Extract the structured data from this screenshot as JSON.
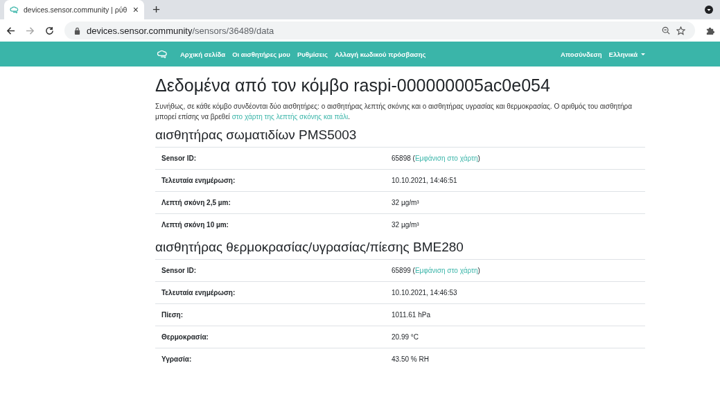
{
  "browser": {
    "tab": {
      "title": "devices.sensor.community | ρύθ",
      "close": "×",
      "selected": true
    },
    "new_tab": "+",
    "address": {
      "host": "devices.sensor.community",
      "path": "/sensors/36489/data"
    }
  },
  "navbar": {
    "links": [
      {
        "label": "Αρχική σελίδα"
      },
      {
        "label": "Οι αισθητήρες μου"
      },
      {
        "label": "Ρυθμίσεις"
      },
      {
        "label": "Αλλαγή κωδικού πρόσβασης"
      }
    ],
    "right": [
      {
        "label": "Αποσύνδεση",
        "dropdown": false
      },
      {
        "label": "Ελληνικά",
        "dropdown": true
      }
    ]
  },
  "title": "Δεδομένα από τον κόμβο raspi-000000005ac0e054",
  "description": {
    "text": "Συνήθως, σε κάθε κόμβο συνδέονται δύο αισθητήρες: ο αισθητήρας λεπτής σκόνης και ο αισθητήρας υγρασίας και θερμοκρασίας. Ο αριθμός του αισθητήρα μπορεί επίσης να βρεθεί ",
    "link": "στο χάρτη της λεπτής σκόνης και πάλι",
    "end": "."
  },
  "sections": [
    {
      "heading": "αισθητήρας σωματιδίων PMS5003",
      "rows": [
        {
          "label": "Sensor ID:",
          "value": "65898",
          "link": {
            "open": "(",
            "text": "Εμφάνιση στο χάρτη",
            "close": ")"
          }
        },
        {
          "label": "Τελευταία ενημέρωση:",
          "value": "10.10.2021, 14:46:51"
        },
        {
          "label": "Λεπτή σκόνη 2,5 µm:",
          "value": "32 µg/m³"
        },
        {
          "label": "Λεπτή σκόνη 10 µm:",
          "value": "32 µg/m³"
        }
      ]
    },
    {
      "heading": "αισθητήρας θερμοκρασίας/υγρασίας/πίεσης BME280",
      "rows": [
        {
          "label": "Sensor ID:",
          "value": "65899",
          "link": {
            "open": "(",
            "text": "Εμφάνιση στο χάρτη",
            "close": ")"
          }
        },
        {
          "label": "Τελευταία ενημέρωση:",
          "value": "10.10.2021, 14:46:53"
        },
        {
          "label": "Πίεση:",
          "value": "1011.61 hPa"
        },
        {
          "label": "Θερμοκρασία:",
          "value": "20.99 °C"
        },
        {
          "label": "Υγρασία:",
          "value": "43.50 % RH"
        }
      ]
    }
  ]
}
